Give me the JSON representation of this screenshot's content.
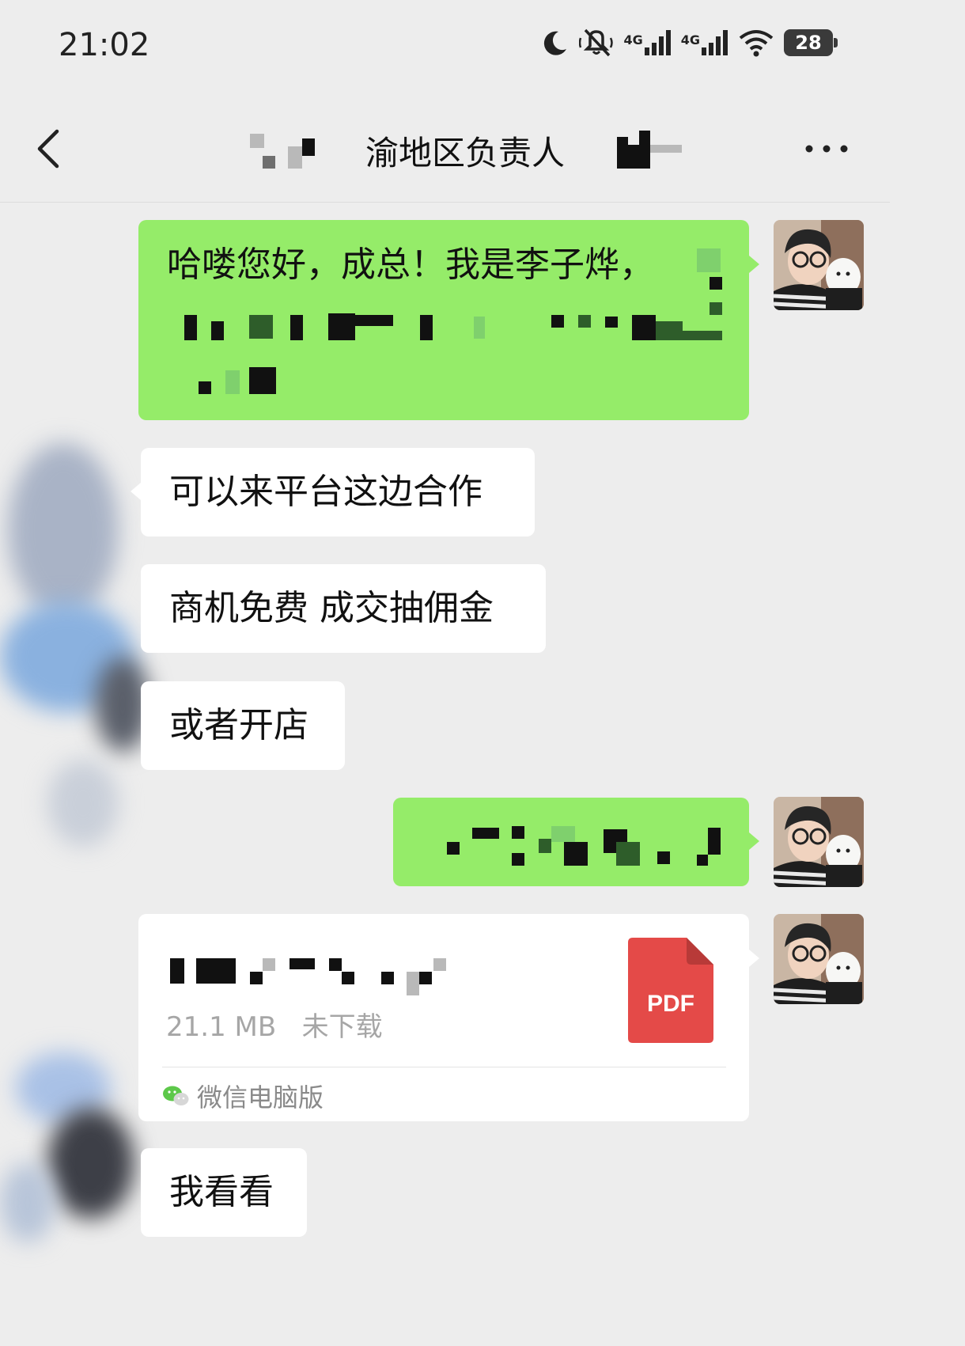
{
  "status_bar": {
    "time": "21:02",
    "battery": "28",
    "network_1": "4G",
    "network_2": "4G"
  },
  "header": {
    "title": "渝地区负责人"
  },
  "messages": [
    {
      "from": "me",
      "text": "哈喽您好，成总！我是李子烨，"
    },
    {
      "from": "them",
      "text": "可以来平台这边合作"
    },
    {
      "from": "them",
      "text": "商机免费 成交抽佣金"
    },
    {
      "from": "them",
      "text": "或者开店"
    },
    {
      "from": "me",
      "text": ""
    },
    {
      "from": "me",
      "type": "file",
      "size": "21.1 MB",
      "status": "未下载",
      "icon_label": "PDF",
      "source": "微信电脑版"
    },
    {
      "from": "them",
      "text": "我看看"
    }
  ],
  "colors": {
    "me_bubble": "#95ec69",
    "them_bubble": "#ffffff",
    "background": "#ededed",
    "pdf": "#e44a48"
  },
  "icons": [
    "moon-icon",
    "mute-icon",
    "signal-icon",
    "wifi-icon",
    "battery-icon",
    "back-icon",
    "more-icon",
    "pdf-icon",
    "wechat-icon"
  ]
}
